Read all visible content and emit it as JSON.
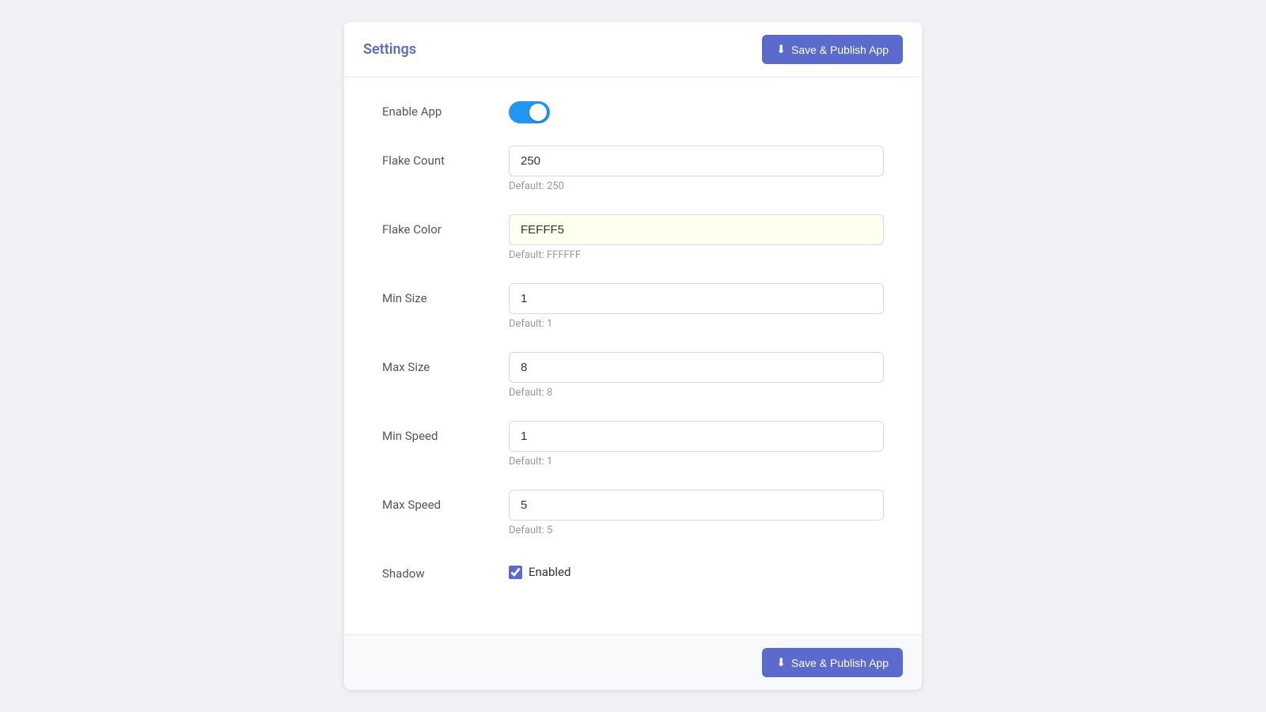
{
  "header": {
    "title": "Settings",
    "save_button_label": "Save & Publish App"
  },
  "fields": {
    "enable_app": {
      "label": "Enable App",
      "value": true
    },
    "flake_count": {
      "label": "Flake Count",
      "value": "250",
      "hint": "Default: 250"
    },
    "flake_color": {
      "label": "Flake Color",
      "value": "FEFFF5",
      "hint": "Default: FFFFFF"
    },
    "min_size": {
      "label": "Min Size",
      "value": "1",
      "hint": "Default: 1"
    },
    "max_size": {
      "label": "Max Size",
      "value": "8",
      "hint": "Default: 8"
    },
    "min_speed": {
      "label": "Min Speed",
      "value": "1",
      "hint": "Default: 1"
    },
    "max_speed": {
      "label": "Max Speed",
      "value": "5",
      "hint": "Default: 5"
    },
    "shadow": {
      "label": "Shadow",
      "checkbox_label": "Enabled",
      "value": true
    }
  },
  "footer": {
    "save_button_label": "Save & Publish App"
  }
}
